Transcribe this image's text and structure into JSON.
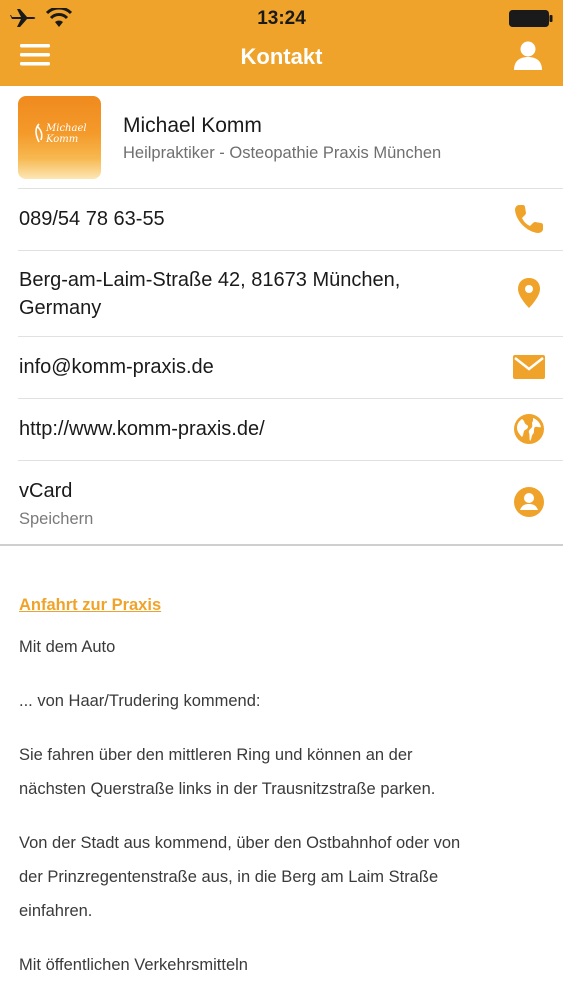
{
  "status_bar": {
    "time": "13:24"
  },
  "navbar": {
    "title": "Kontakt"
  },
  "profile": {
    "logo_text_line1": "Michael",
    "logo_text_line2": "Komm",
    "name": "Michael Komm",
    "subtitle": "Heilpraktiker - Osteopathie Praxis München"
  },
  "contact": {
    "phone": "089/54 78 63-55",
    "address_line1": "Berg-am-Laim-Straße 42, 81673 München,",
    "address_line2": "Germany",
    "email": "info@komm-praxis.de",
    "website": "http://www.komm-praxis.de/",
    "vcard_label": "vCard",
    "vcard_sub": "Speichern"
  },
  "content": {
    "link": "Anfahrt zur Praxis",
    "p1": "Mit dem Auto",
    "p2": "... von Haar/Trudering kommend:",
    "p3_line1": "Sie fahren über den mittleren Ring und können an der",
    "p3_line2": "nächsten Querstraße links in der Trausnitzstraße parken.",
    "p4_line1": "Von der Stadt aus kommend, über den Ostbahnhof oder von",
    "p4_line2": "der Prinzregentenstraße aus, in die Berg am Laim Straße",
    "p4_line3": "einfahren.",
    "p5": "Mit öffentlichen Verkehrsmitteln"
  },
  "colors": {
    "accent": "#F0A32A",
    "text": "#1a1a1a",
    "secondary_text": "#6f6f6f"
  },
  "icons": {
    "status": [
      "airplane-icon",
      "wifi-icon",
      "battery-icon"
    ],
    "navbar": [
      "menu-icon",
      "user-icon"
    ],
    "rows": [
      "phone-icon",
      "location-pin-icon",
      "envelope-icon",
      "globe-icon",
      "contact-card-icon"
    ]
  }
}
